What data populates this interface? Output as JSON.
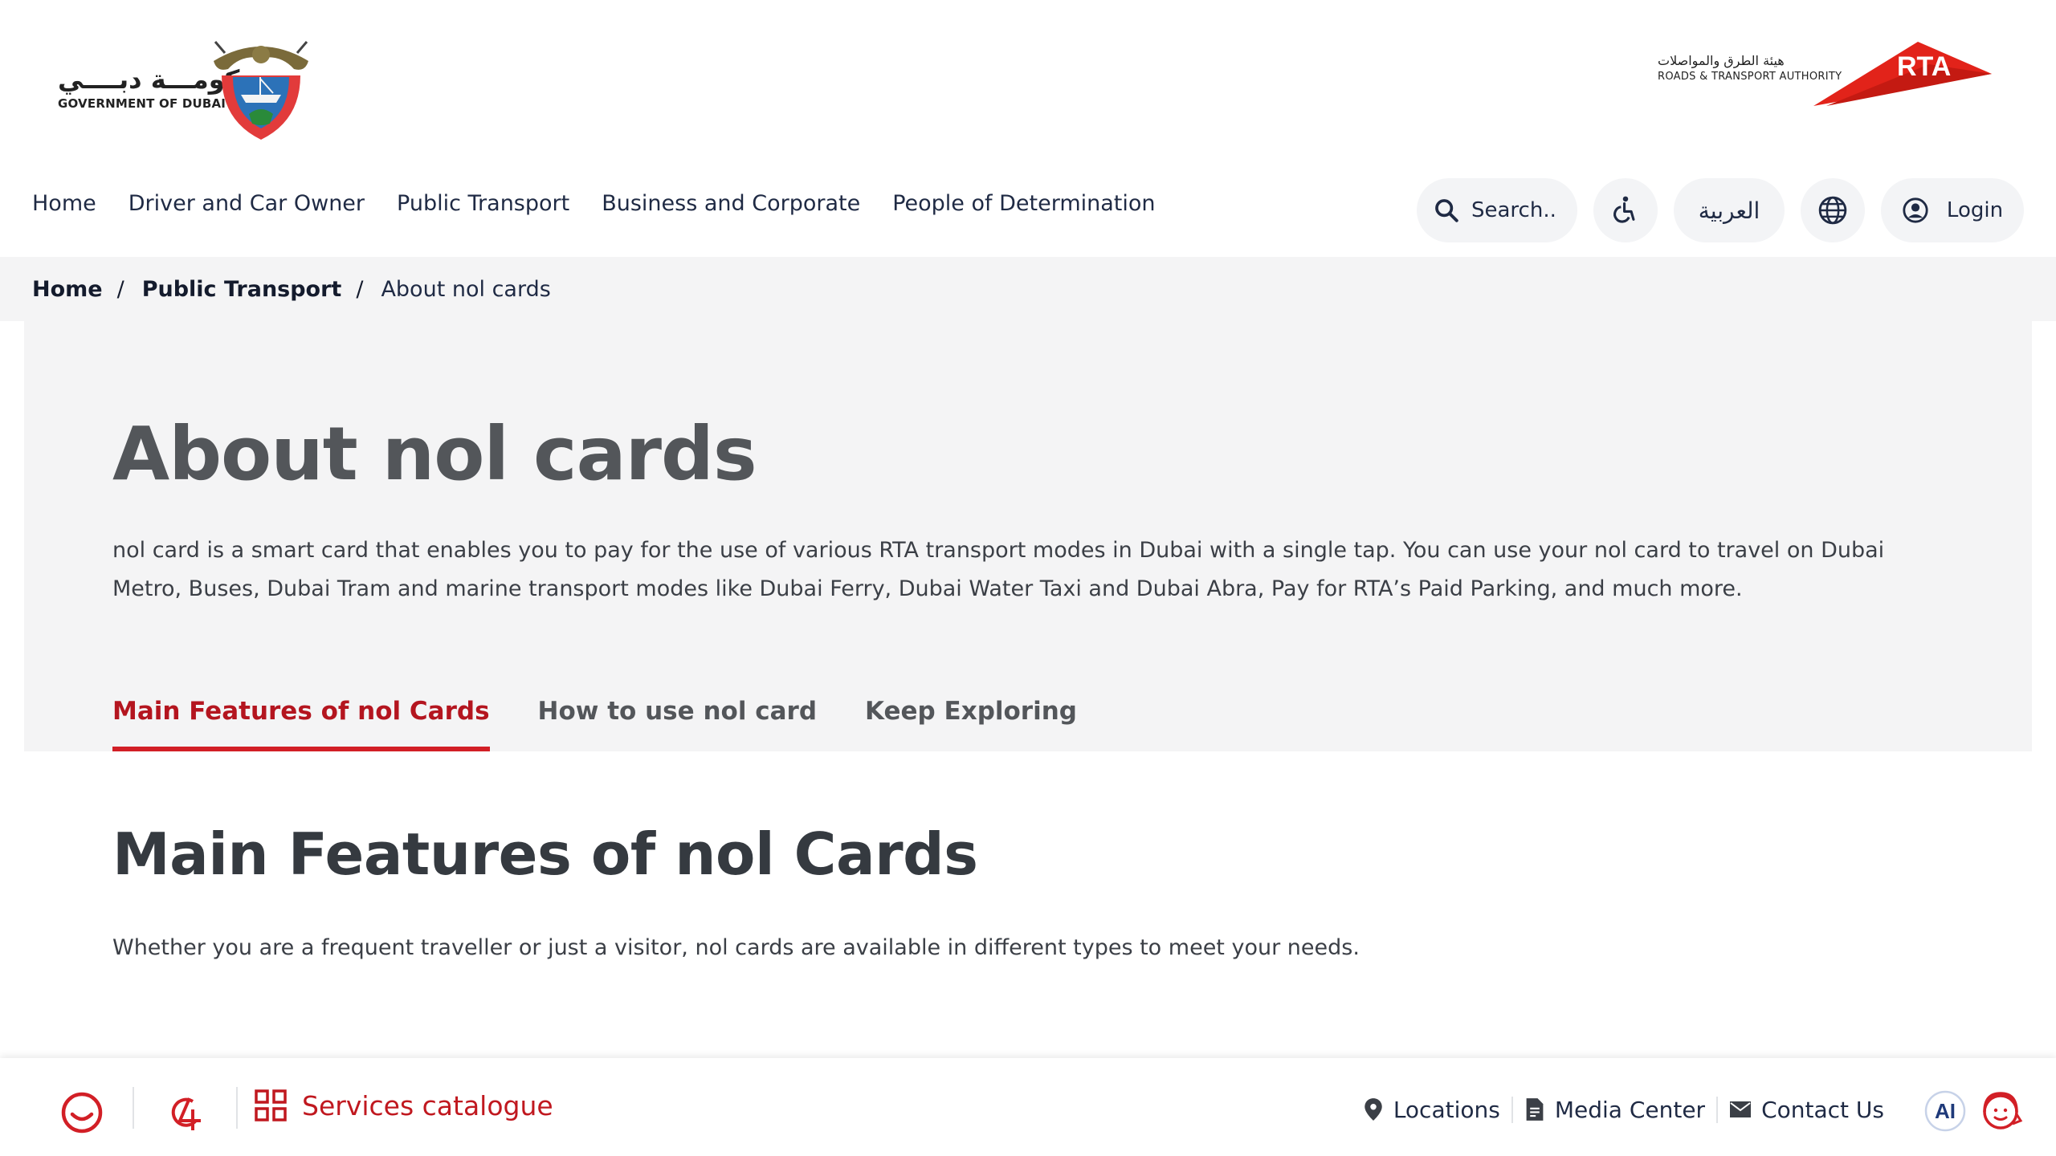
{
  "header": {
    "gov_logo": {
      "text_ar": "حكومـــة دبــــي",
      "text_en": "GOVERNMENT OF DUBAI"
    },
    "rta_logo": {
      "text_ar": "هيئة الطرق والمواصلات",
      "text_en": "ROADS & TRANSPORT AUTHORITY",
      "mark": "RTA"
    }
  },
  "nav": {
    "items": [
      {
        "label": "Home"
      },
      {
        "label": "Driver and Car Owner"
      },
      {
        "label": "Public Transport"
      },
      {
        "label": "Business and Corporate"
      },
      {
        "label": "People of Determination"
      }
    ],
    "search_placeholder": "Search..",
    "language_label": "العربية",
    "login_label": "Login"
  },
  "breadcrumb": {
    "items": [
      {
        "label": "Home"
      },
      {
        "label": "Public Transport"
      },
      {
        "label": "About nol cards"
      }
    ],
    "separator": "/"
  },
  "hero": {
    "title": "About nol cards",
    "description": "nol card is a smart card that enables you to pay for the use of various RTA transport modes in Dubai with a single tap. You can use your nol card to travel on Dubai Metro, Buses, Dubai Tram and marine transport modes like Dubai Ferry, Dubai Water Taxi and Dubai Abra, Pay for RTA’s Paid Parking, and much more.",
    "tabs": [
      {
        "label": "Main Features of nol Cards",
        "active": true
      },
      {
        "label": "How to use nol card",
        "active": false
      },
      {
        "label": "Keep Exploring",
        "active": false
      }
    ]
  },
  "section": {
    "title": "Main Features of nol Cards",
    "description": "Whether you are a frequent traveller or just a visitor, nol cards are available in different types to meet your needs."
  },
  "bottom_bar": {
    "services_label": "Services catalogue",
    "links": [
      {
        "label": "Locations",
        "icon": "location-pin-icon"
      },
      {
        "label": "Media Center",
        "icon": "document-icon"
      },
      {
        "label": "Contact Us",
        "icon": "mail-icon"
      }
    ],
    "ai_label": "AI"
  },
  "colors": {
    "accent_red": "#d21f26",
    "active_tab": "#b4151f",
    "nav_text": "#1f2a44",
    "panel_bg": "#f4f4f5"
  }
}
